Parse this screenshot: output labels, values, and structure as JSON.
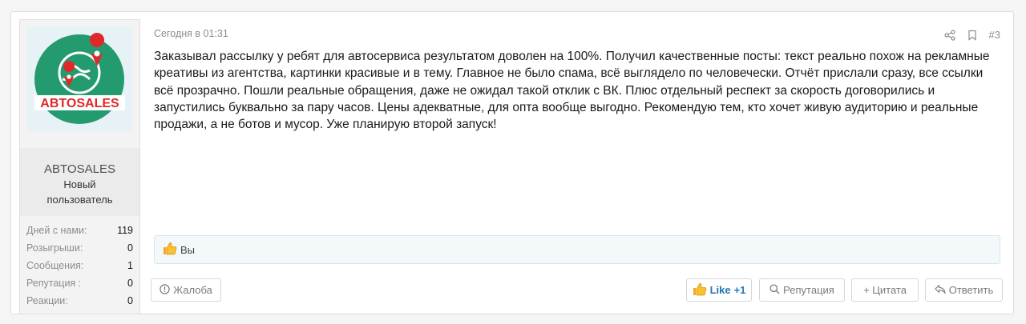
{
  "user": {
    "name": "ABTOSALES",
    "title": "Новый пользователь",
    "avatar_text": "ABTOSALES",
    "stats": [
      {
        "label": "Дней с нами:",
        "value": "119"
      },
      {
        "label": "Розыгрыши:",
        "value": "0"
      },
      {
        "label": "Сообщения:",
        "value": "1"
      },
      {
        "label": "Репутация :",
        "value": "0"
      },
      {
        "label": "Реакции:",
        "value": "0"
      }
    ]
  },
  "post": {
    "timestamp": "Сегодня в 01:31",
    "number": "#3",
    "body": "Заказывал рассылку у ребят для автосервиса результатом доволен на 100%. Получил качественные посты: текст реально похож на рекламные креативы из агентства, картинки красивые и в тему. Главное не было спама, всё выглядело по человечески. Отчёт прислали сразу, все ссылки всё прозрачно. Пошли реальные обращения, даже не ожидал такой отклик с ВК. Плюс отдельный респект за скорость договорились и запустились буквально за пару часов. Цены адекватные, для опта вообще выгодно. Рекомендую тем, кто хочет живую аудиторию и реальные продажи, а не ботов и мусор. Уже планирую второй запуск!",
    "reactions_text": "Вы"
  },
  "actions": {
    "report": "Жалоба",
    "like": "Like",
    "like_count": "+1",
    "reputation": "Репутация",
    "quote": "+ Цитата",
    "reply": "Ответить"
  },
  "colors": {
    "accent": "#2577b1",
    "avatar_green": "#239b6e",
    "avatar_red": "#e0282a"
  }
}
